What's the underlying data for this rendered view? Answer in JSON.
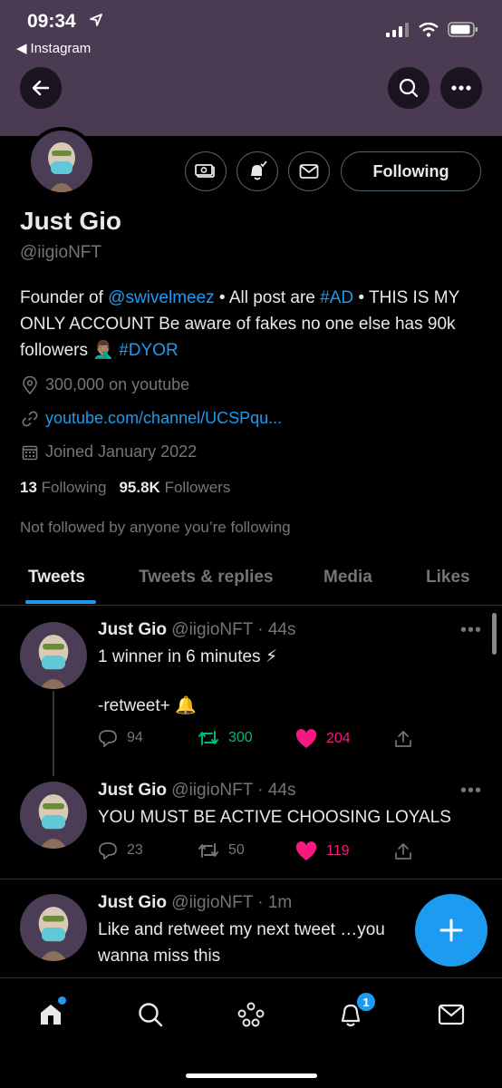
{
  "status_bar": {
    "time": "09:34",
    "back_app": "Instagram"
  },
  "profile": {
    "name": "Just Gio",
    "handle": "@iigioNFT",
    "following_button": "Following",
    "bio": {
      "part1": "Founder of ",
      "mention": "@swivelmeez",
      "part2": " • All post are ",
      "hashtag_ad": "#AD",
      "part3": " • THIS IS MY ONLY ACCOUNT Be aware of fakes no one else has 90k followers ",
      "emoji": "🤦🏽‍♂️",
      "hashtag_dyor": "#DYOR"
    },
    "location": "300,000 on youtube",
    "website": "youtube.com/channel/UCSPqu...",
    "joined": "Joined January 2022",
    "following_count": "13",
    "following_label": "Following",
    "followers_count": "95.8K",
    "followers_label": "Followers",
    "not_followed": "Not followed by anyone you’re following"
  },
  "tabs": [
    {
      "label": "Tweets"
    },
    {
      "label": "Tweets & replies"
    },
    {
      "label": "Media"
    },
    {
      "label": "Likes"
    }
  ],
  "tweets": [
    {
      "name": "Just Gio",
      "meta": "@iigioNFT · 44s",
      "line1": "1 winner in 6 minutes ⚡",
      "line2": "",
      "line3": "-retweet+ 🔔",
      "replies": "94",
      "retweets": "300",
      "likes": "204"
    },
    {
      "name": "Just Gio",
      "meta": "@iigioNFT · 44s",
      "line1": "YOU MUST BE ACTIVE CHOOSING LOYALS",
      "replies": "23",
      "retweets": "50",
      "likes": "119"
    },
    {
      "name": "Just Gio",
      "meta": "@iigioNFT · 1m",
      "line1": "Like and retweet my next tweet …you",
      "line2": "wanna miss this"
    }
  ],
  "bottom_nav": {
    "notifications_badge": "1"
  },
  "colors": {
    "accent": "#1d9bf0",
    "retweet": "#00ba7c",
    "like": "#f91880",
    "banner": "#4a3a52"
  }
}
